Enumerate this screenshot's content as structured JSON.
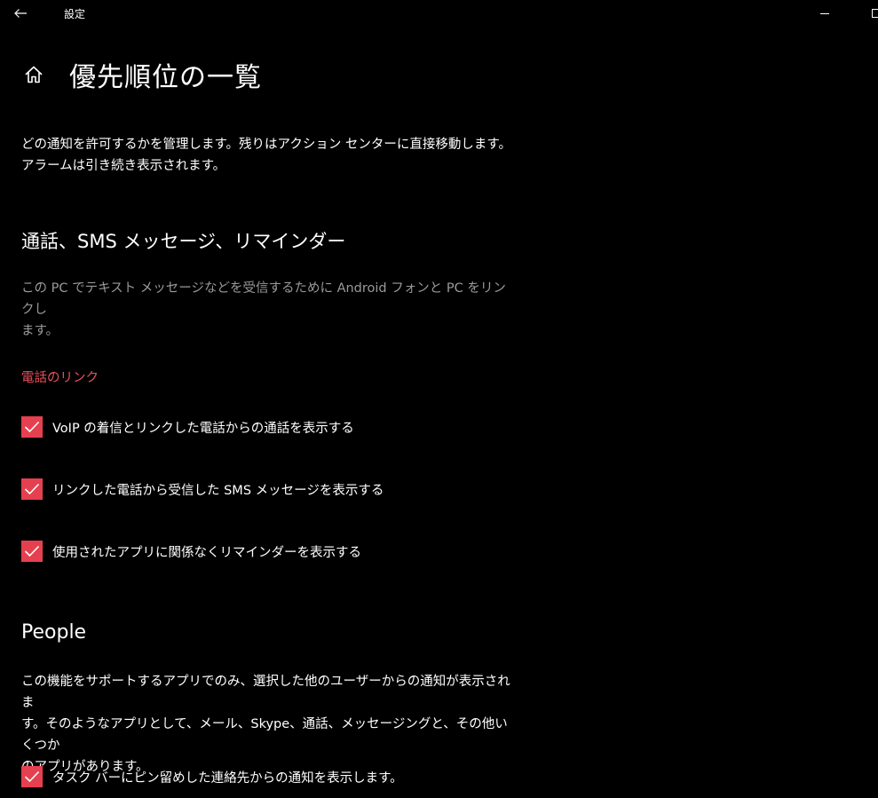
{
  "titlebar": {
    "app_title": "設定"
  },
  "header": {
    "title": "優先順位の一覧"
  },
  "intro": {
    "line1": "どの通知を許可するかを管理します。残りはアクション センターに直接移動します。",
    "line2": "アラームは引き続き表示されます。"
  },
  "calls_section": {
    "heading": "通話、SMS メッセージ、リマインダー",
    "description_line1": "この PC でテキスト メッセージなどを受信するために Android フォンと PC をリンクし",
    "description_line2": "ます。",
    "group_label": "電話のリンク",
    "options": [
      {
        "label": "VoIP の着信とリンクした電話からの通話を表示する",
        "checked": true
      },
      {
        "label": "リンクした電話から受信した SMS メッセージを表示する",
        "checked": true
      },
      {
        "label": "使用されたアプリに関係なくリマインダーを表示する",
        "checked": true
      }
    ]
  },
  "people_section": {
    "heading": "People",
    "description_line1": "この機能をサポートするアプリでのみ、選択した他のユーザーからの通知が表示されま",
    "description_line2": "す。そのようなアプリとして、メール、Skype、通話、メッセージングと、その他いくつか",
    "description_line3": "のアプリがあります。",
    "options": [
      {
        "label": "タスク バーにピン留めした連絡先からの通知を表示します。",
        "checked": true
      }
    ]
  },
  "colors": {
    "background": "#000000",
    "accent": "#e5404f",
    "group_label": "#e8505b",
    "muted_text": "#9a9a9a"
  },
  "icons": {
    "back": "back-arrow-icon",
    "home": "home-icon",
    "minimize": "minimize-icon",
    "maximize": "maximize-icon",
    "check": "checkmark-icon"
  }
}
